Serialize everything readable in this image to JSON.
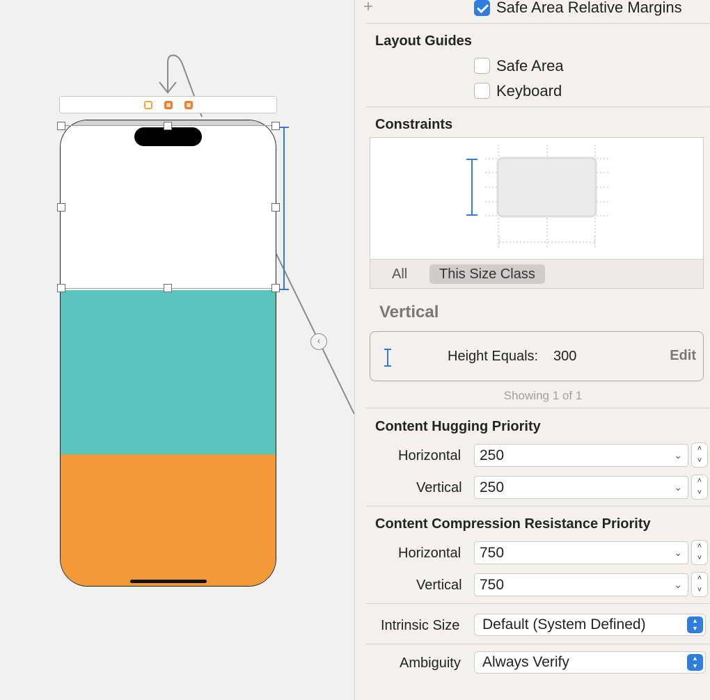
{
  "inspector": {
    "relative_margins": {
      "label": "Safe Area Relative Margins",
      "checked": true
    },
    "layout_guides": {
      "title": "Layout Guides",
      "items": [
        {
          "label": "Safe Area",
          "checked": false
        },
        {
          "label": "Keyboard",
          "checked": false
        }
      ]
    },
    "constraints": {
      "title": "Constraints",
      "segments": [
        {
          "label": "All",
          "active": false
        },
        {
          "label": "This Size Class",
          "active": true
        }
      ]
    },
    "vertical": {
      "title": "Vertical",
      "row": {
        "label": "Height Equals:",
        "value": "300",
        "edit": "Edit"
      },
      "showing": "Showing 1 of 1"
    },
    "hugging": {
      "title": "Content Hugging Priority",
      "horizontal_label": "Horizontal",
      "horizontal_value": "250",
      "vertical_label": "Vertical",
      "vertical_value": "250"
    },
    "compression": {
      "title": "Content Compression Resistance Priority",
      "horizontal_label": "Horizontal",
      "horizontal_value": "750",
      "vertical_label": "Vertical",
      "vertical_value": "750"
    },
    "intrinsic": {
      "label": "Intrinsic Size",
      "value": "Default (System Defined)"
    },
    "ambiguity": {
      "label": "Ambiguity",
      "value": "Always Verify"
    }
  },
  "canvas": {
    "colors": {
      "white_view": "#ffffff",
      "teal_view": "#5bc5bd",
      "orange_view": "#f19a37",
      "constraint_blue": "#3a77d4"
    },
    "scene_icons": [
      "view-controller-icon",
      "first-responder-icon",
      "exit-icon"
    ]
  }
}
